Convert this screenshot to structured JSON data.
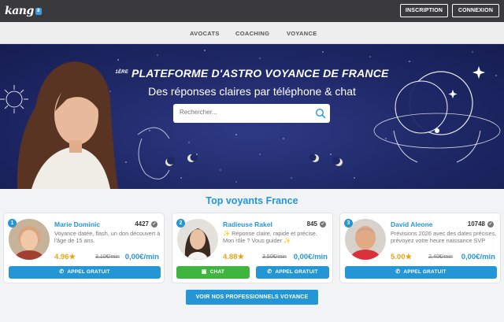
{
  "header": {
    "logo_text": "kang",
    "logo_badge": "8",
    "inscription": "INSCRIPTION",
    "connexion": "CONNEXION"
  },
  "nav": {
    "items": [
      "AVOCATS",
      "COACHING",
      "VOYANCE"
    ]
  },
  "hero": {
    "title_sup": "1ÈRE",
    "title": "PLATEFORME D'ASTRO VOYANCE DE FRANCE",
    "subtitle": "Des réponses claires par téléphone & chat",
    "search_placeholder": "Rechercher..."
  },
  "section": {
    "title": "Top voyants France"
  },
  "cards": [
    {
      "rank": "1",
      "name": "Marie Dominic",
      "count": "4427",
      "desc": "Voyance datée, flash, un don découvert à l'âge de 15 ans.",
      "rating": "4.96",
      "old_price": "3,10€/min",
      "new_price": "0,00€/min",
      "call_label": "APPEL GRATUIT"
    },
    {
      "rank": "2",
      "name": "Radieuse Rakel",
      "count": "845",
      "desc": "✨ Réponse claire, rapide et précise. Mon rôle ? Vous guider ✨",
      "rating": "4.88",
      "old_price": "3,50€/min",
      "new_price": "0,00€/min",
      "chat_label": "CHAT",
      "call_label": "APPEL GRATUIT"
    },
    {
      "rank": "3",
      "name": "David Aleone",
      "count": "10748",
      "desc": "Prévisions 2026 avec des dates précises, prévoyez votre heure naissance SVP",
      "rating": "5.00",
      "old_price": "2,40€/min",
      "new_price": "0,00€/min",
      "call_label": "APPEL GRATUIT"
    }
  ],
  "cta": "VOIR NOS PROFESSIONNELS VOYANCE",
  "colors": {
    "accent": "#2496d6",
    "chat_green": "#3fb53f",
    "star": "#e8a415",
    "topbar": "#3a3a3c"
  }
}
